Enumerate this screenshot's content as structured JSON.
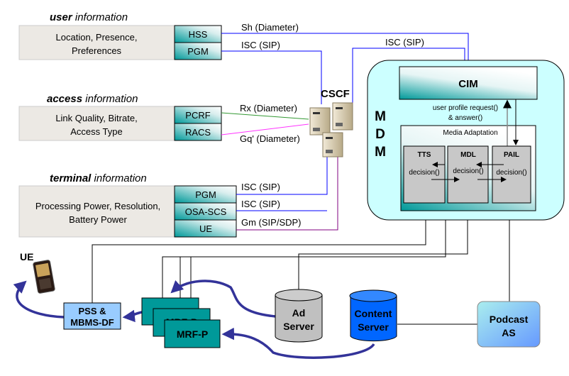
{
  "groups": {
    "user": {
      "title_bold": "user",
      "title_rest": " information",
      "lines": [
        "Location, Presence,",
        "Preferences"
      ],
      "entities": [
        "HSS",
        "PGM"
      ]
    },
    "access": {
      "title_bold": "access",
      "title_rest": " information",
      "lines": [
        "Link Quality, Bitrate,",
        "Access Type"
      ],
      "entities": [
        "PCRF",
        "RACS"
      ]
    },
    "terminal": {
      "title_bold": "terminal",
      "title_rest": " information",
      "lines": [
        "Processing Power, Resolution,",
        "Battery Power"
      ],
      "entities": [
        "PGM",
        "OSA-SCS",
        "UE"
      ]
    }
  },
  "interfaces": {
    "sh": "Sh (Diameter)",
    "isc_user": "ISC (SIP)",
    "isc_cscf_mdm": "ISC (SIP)",
    "rx": "Rx (Diameter)",
    "gq": "Gq' (Diameter)",
    "isc_pgm": "ISC (SIP)",
    "isc_osa": "ISC (SIP)",
    "gm": "Gm (SIP/SDP)"
  },
  "cscf": "CSCF",
  "mdm": {
    "letters": [
      "M",
      "D",
      "M"
    ],
    "cim": "CIM",
    "profile_lines": [
      "user profile request()",
      "& answer()"
    ],
    "media_adaptation": "Media Adaptation",
    "modules": [
      {
        "name": "TTS",
        "call": "decision()"
      },
      {
        "name": "MDL",
        "call": "decision()"
      },
      {
        "name": "PAIL",
        "call": "decision()"
      }
    ]
  },
  "bottom": {
    "ue_label": "UE",
    "pss": [
      "PSS &",
      "MBMS-DF"
    ],
    "mrf": [
      "MRF-P",
      "MRF-P",
      "MRF-P"
    ],
    "ad_server": [
      "Ad",
      "Server"
    ],
    "content_server": [
      "Content",
      "Server"
    ],
    "podcast": [
      "Podcast",
      "AS"
    ]
  },
  "colors": {
    "teal": "#009999",
    "mdm_fill": "#ccffff",
    "pss_fill": "#99ccff",
    "content_fill": "#0066ff",
    "flow_arrow": "#333399",
    "sip_line": "#0000ff",
    "rx_line": "#339933",
    "gq_line": "#ff33ff",
    "gm_line": "#800080"
  }
}
